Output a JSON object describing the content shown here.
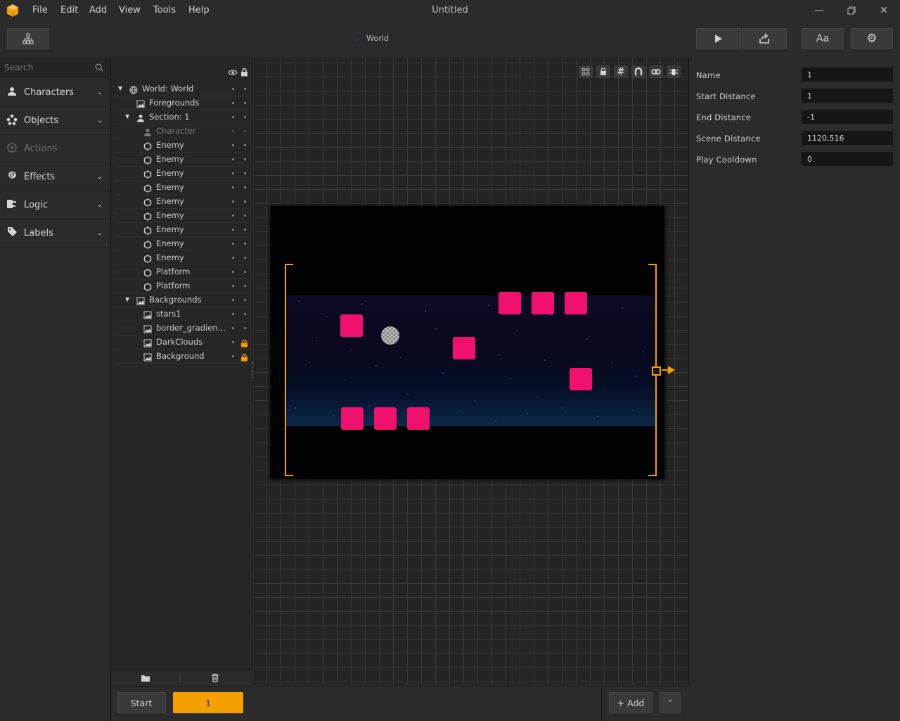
{
  "window": {
    "title": "Untitled"
  },
  "menu": {
    "items": [
      "File",
      "Edit",
      "Add",
      "View",
      "Tools",
      "Help"
    ]
  },
  "toolbar": {
    "breadcrumb": "World",
    "font_button_label": "Aa"
  },
  "sidebar": {
    "search_placeholder": "Search",
    "categories": [
      {
        "label": "Characters",
        "icon": "person-icon",
        "enabled": true
      },
      {
        "label": "Objects",
        "icon": "nodes-icon",
        "enabled": true
      },
      {
        "label": "Actions",
        "icon": "play-circle-icon",
        "enabled": false
      },
      {
        "label": "Effects",
        "icon": "swirl-icon",
        "enabled": true
      },
      {
        "label": "Logic",
        "icon": "logic-icon",
        "enabled": true
      },
      {
        "label": "Labels",
        "icon": "tag-icon",
        "enabled": true
      }
    ]
  },
  "hierarchy": {
    "rows": [
      {
        "label": "World: World",
        "icon": "globe-icon",
        "expanded": true
      },
      {
        "label": "Foregrounds",
        "icon": "image-icon"
      },
      {
        "label": "Section: 1",
        "icon": "person-icon",
        "expanded": true
      },
      {
        "label": "Character",
        "icon": "person-icon",
        "dimmed": true
      },
      {
        "label": "Enemy",
        "icon": "hexagon-icon"
      },
      {
        "label": "Enemy",
        "icon": "hexagon-icon"
      },
      {
        "label": "Enemy",
        "icon": "hexagon-icon"
      },
      {
        "label": "Enemy",
        "icon": "hexagon-icon"
      },
      {
        "label": "Enemy",
        "icon": "hexagon-icon"
      },
      {
        "label": "Enemy",
        "icon": "hexagon-icon"
      },
      {
        "label": "Enemy",
        "icon": "hexagon-icon"
      },
      {
        "label": "Enemy",
        "icon": "hexagon-icon"
      },
      {
        "label": "Enemy",
        "icon": "hexagon-icon"
      },
      {
        "label": "Platform",
        "icon": "hexagon-icon"
      },
      {
        "label": "Platform",
        "icon": "hexagon-icon"
      },
      {
        "label": "Backgrounds",
        "icon": "image-icon",
        "expanded": true
      },
      {
        "label": "stars1",
        "icon": "image-icon"
      },
      {
        "label": "border_gradien…",
        "icon": "image-icon"
      },
      {
        "label": "DarkClouds",
        "icon": "image-icon",
        "locked": true
      },
      {
        "label": "Background",
        "icon": "image-icon",
        "locked": true
      }
    ]
  },
  "properties": {
    "fields": [
      {
        "label": "Name",
        "value": "1"
      },
      {
        "label": "Start Distance",
        "value": "1"
      },
      {
        "label": "End Distance",
        "value": "-1"
      },
      {
        "label": "Scene Distance",
        "value": "1120,516"
      },
      {
        "label": "Play Cooldown",
        "value": "0"
      }
    ]
  },
  "bottombar": {
    "start_label": "Start",
    "section_label": "1",
    "add_label": "+ Add"
  },
  "colors": {
    "accent": "#f5a000",
    "enemy": "#f0116e"
  }
}
